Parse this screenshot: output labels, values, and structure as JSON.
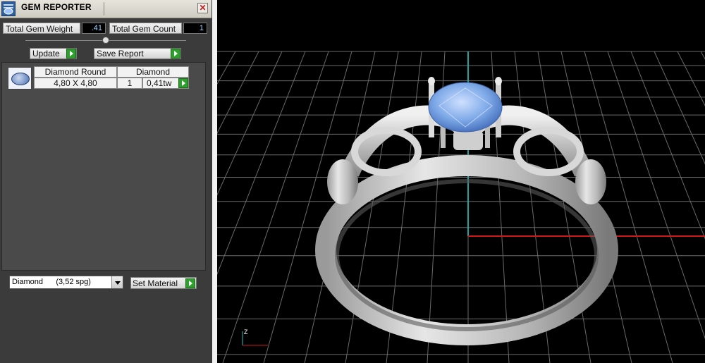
{
  "window": {
    "title": "GEM REPORTER",
    "close_glyph": "✕"
  },
  "totals": {
    "weight_label": "Total Gem Weight",
    "weight_value": ".41",
    "count_label": "Total Gem Count",
    "count_value": "1"
  },
  "actions": {
    "update_label": "Update",
    "save_report_label": "Save Report"
  },
  "gem_row": {
    "shape": "Diamond Round",
    "size": "4,80 X 4,80",
    "material": "Diamond",
    "count": "1",
    "weight": "0,41tw"
  },
  "material_select": {
    "value": "Diamond      (3,52 spg)"
  },
  "set_material_label": "Set Material",
  "viewport": {
    "axis_label": "Z",
    "grid_color": "#6a6a6a",
    "x_axis_color": "#cc1a1a",
    "z_axis_color": "#1fa3a3",
    "gem_color": "#6aa0e8"
  }
}
